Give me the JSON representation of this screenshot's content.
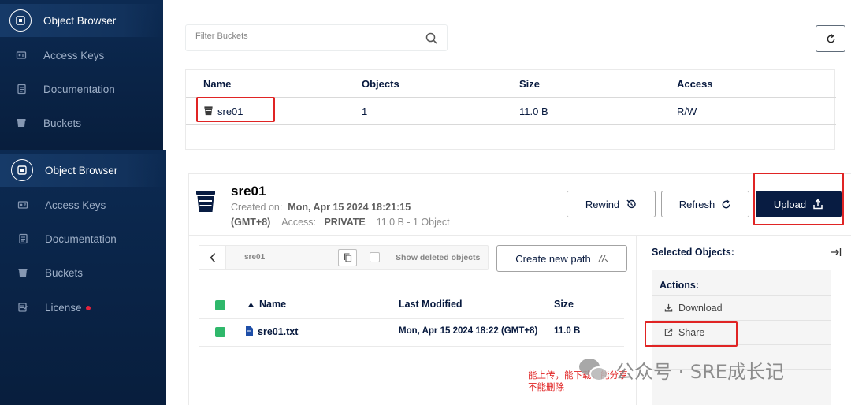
{
  "sidebar_top": {
    "items": [
      {
        "label": "Object Browser",
        "icon": "object-browser-icon",
        "active": true
      },
      {
        "label": "Access Keys",
        "icon": "key-icon"
      },
      {
        "label": "Documentation",
        "icon": "docs-icon"
      },
      {
        "label": "Buckets",
        "icon": "bucket-icon"
      }
    ]
  },
  "sidebar_bottom": {
    "items": [
      {
        "label": "Object Browser",
        "icon": "object-browser-icon",
        "active": true
      },
      {
        "label": "Access Keys",
        "icon": "key-icon"
      },
      {
        "label": "Documentation",
        "icon": "docs-icon"
      },
      {
        "label": "Buckets",
        "icon": "bucket-icon"
      },
      {
        "label": "License",
        "icon": "license-icon",
        "badge_color": "#e5233b"
      }
    ]
  },
  "top_panel": {
    "filter_placeholder": "Filter Buckets",
    "columns": [
      "Name",
      "Objects",
      "Size",
      "Access"
    ],
    "rows": [
      {
        "name": "sre01",
        "objects": "1",
        "size": "11.0 B",
        "access": "R/W"
      }
    ]
  },
  "bucket_detail": {
    "title": "sre01",
    "created_label": "Created on:",
    "created_value": "Mon, Apr 15 2024 18:21:15",
    "timezone": "(GMT+8)",
    "access_label": "Access:",
    "access_value": "PRIVATE",
    "summary": "11.0 B - 1 Object",
    "buttons": {
      "rewind": "Rewind",
      "refresh": "Refresh",
      "upload": "Upload"
    }
  },
  "object_list": {
    "path": "sre01",
    "show_deleted": "Show deleted objects",
    "create_path": "Create new path",
    "columns": [
      "Name",
      "Last Modified",
      "Size"
    ],
    "rows": [
      {
        "name": "sre01.txt",
        "modified": "Mon, Apr 15 2024 18:22 (GMT+8)",
        "size": "11.0 B",
        "checked": true
      }
    ]
  },
  "selected_panel": {
    "title": "Selected Objects:",
    "actions_title": "Actions:",
    "actions": [
      "Download",
      "Share"
    ]
  },
  "annotation": {
    "line1": "能上传，能下载，能分享",
    "line2": "不能删除",
    "color": "#e02424"
  },
  "watermark": "公众号 · SRE成长记",
  "colors": {
    "sidebar": "#0a2547",
    "primary": "#081c42",
    "check": "#2fb86b",
    "highlight": "#e02424"
  }
}
